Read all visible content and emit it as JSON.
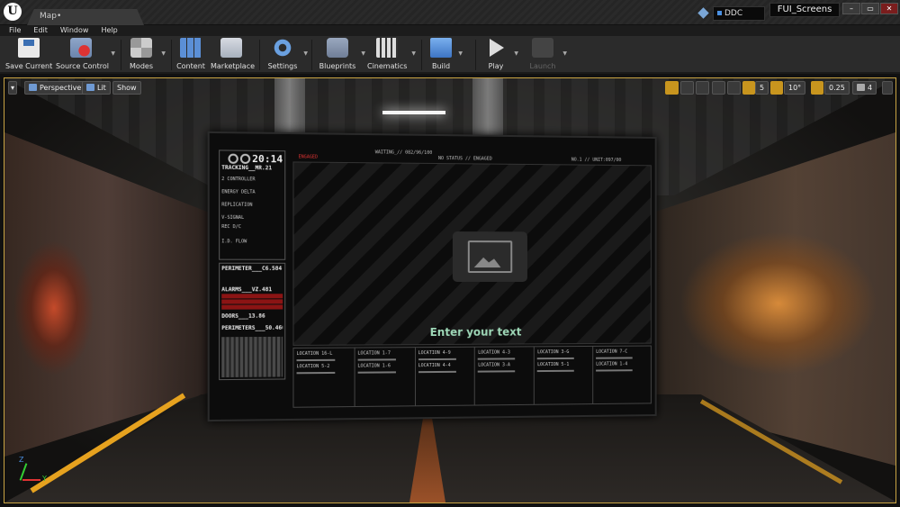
{
  "title_bar": {
    "tab": "Map•",
    "ddc": "DDC",
    "project": "FUI_Screens",
    "window_buttons": [
      "–",
      "▭",
      "✕"
    ]
  },
  "menu": [
    "File",
    "Edit",
    "Window",
    "Help"
  ],
  "toolbar": {
    "buttons": [
      {
        "label": "Save Current",
        "icon": "save-icon"
      },
      {
        "label": "Source Control",
        "icon": "source-control-icon"
      },
      {
        "label": "Modes",
        "icon": "modes-icon"
      },
      {
        "label": "Content",
        "icon": "content-icon"
      },
      {
        "label": "Marketplace",
        "icon": "marketplace-icon"
      },
      {
        "label": "Settings",
        "icon": "settings-icon"
      },
      {
        "label": "Blueprints",
        "icon": "blueprints-icon"
      },
      {
        "label": "Cinematics",
        "icon": "cinematics-icon"
      },
      {
        "label": "Build",
        "icon": "build-icon"
      },
      {
        "label": "Play",
        "icon": "play-icon"
      },
      {
        "label": "Launch",
        "icon": "launch-icon"
      }
    ]
  },
  "viewport": {
    "view_mode": "Perspective",
    "lighting": "Lit",
    "show": "Show",
    "grid_snap": "5",
    "rotation_snap": "10°",
    "scale_snap": "0.25",
    "camera_speed": "4"
  },
  "fui": {
    "clock": "20:14",
    "tracking": "TRACKING__MR.21",
    "left_items": [
      "2 CONTROLLER",
      "ENERGY DELTA",
      "REPLICATION",
      "V-SIGNAL",
      "REC D/C",
      "I.D. FLOW"
    ],
    "perimeter": "PERIMETER___C6.584",
    "alarms": "ALARMS___VZ.481",
    "doors": "DOORS___13.86",
    "perimeters": "PERIMETERS___50.460",
    "top_labels": [
      "ENGAGED",
      "WAITING_// 082/96/100",
      "NO STATUS // ENGAGED",
      "NO.1 // UNIT:097/00"
    ],
    "placeholder_text": "Enter your text",
    "locations": [
      "LOCATION 16-L",
      "LOCATION 1-7",
      "LOCATION 4-9",
      "LOCATION 4-3",
      "LOCATION 5-2",
      "LOCATION 1-6",
      "LOCATION 4-4",
      "LOCATION 3-A",
      "LOCATION 3-G",
      "LOCATION 5-1",
      "LOCATION 7-C",
      "LOCATION 1-4"
    ]
  },
  "colors": {
    "accent": "#c8951e",
    "viewport_border": "#c9a443",
    "fui_text": "#9fd8b8",
    "alarm_red": "#8b1414"
  }
}
